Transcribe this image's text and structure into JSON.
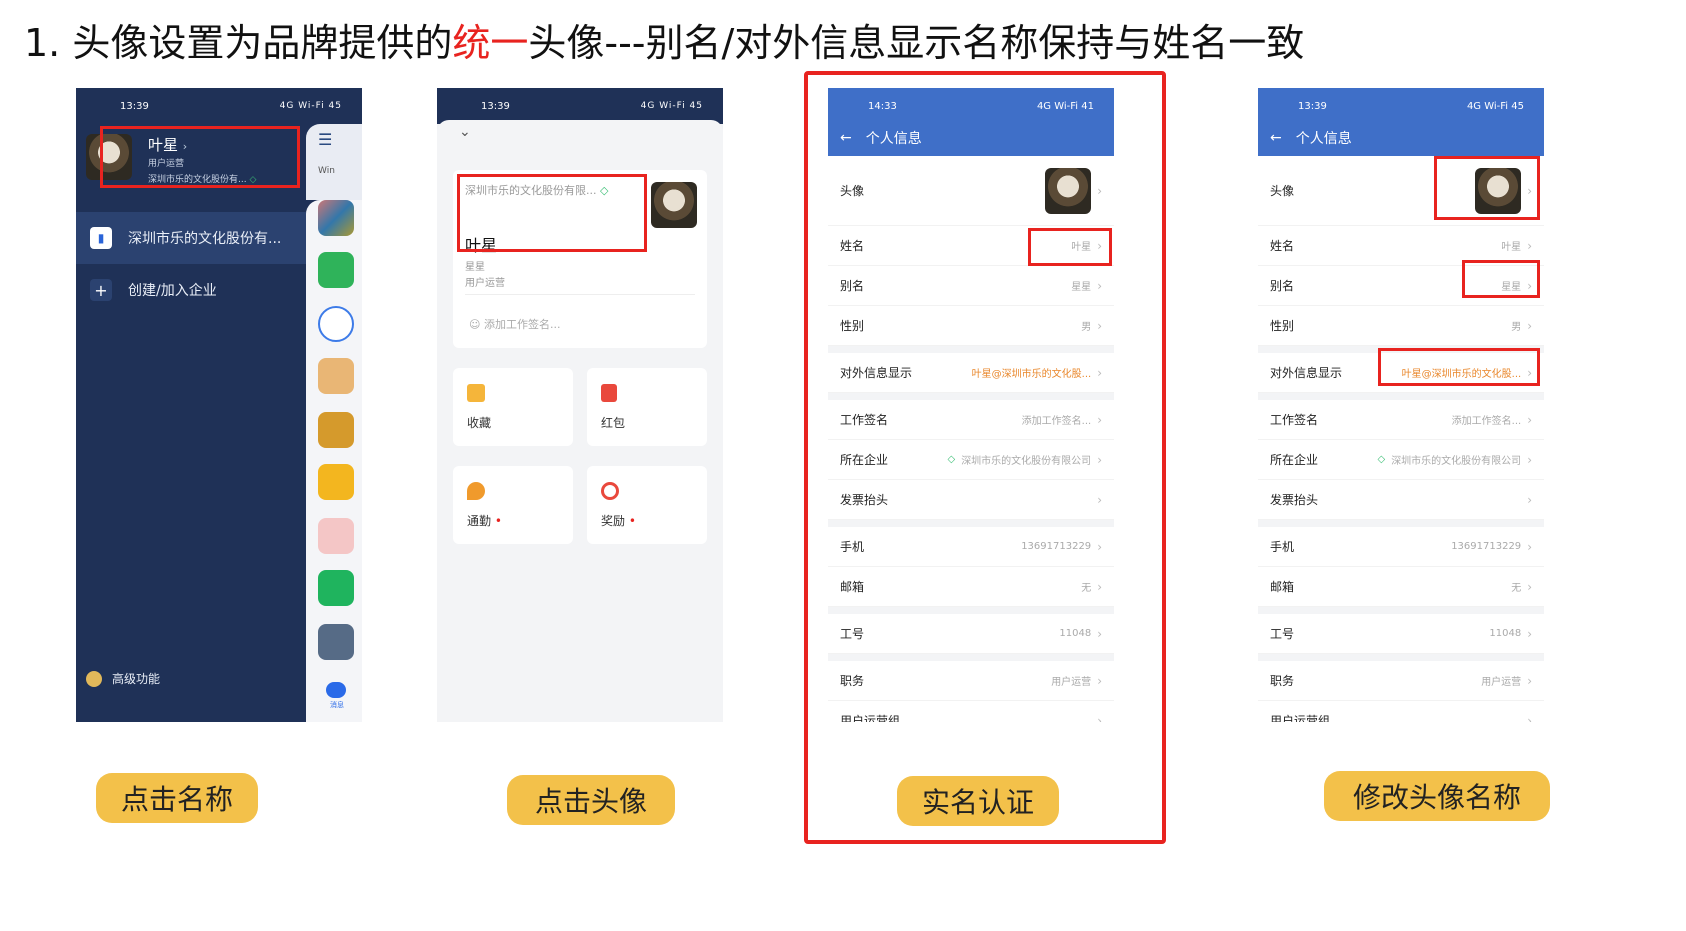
{
  "title": {
    "part1": "1. 头像设置为品牌提供的",
    "highlight": "统一",
    "part2": "头像---别名/对外信息显示名称保持与姓名一致"
  },
  "colors": {
    "highlight": "#e8231f",
    "pill": "#f3c14a",
    "header_blue": "#3f6fc8",
    "sidebar": "#1f3157"
  },
  "phone1": {
    "time": "13:39",
    "status_right": "4G Wi-Fi 45",
    "name": "叶星",
    "role": "用户运营",
    "company_short": "深圳市乐的文化股份有...",
    "company_item": "深圳市乐的文化股份有...",
    "create_join": "创建/加入企业",
    "advanced": "高级功能",
    "strip_label": "Win",
    "msg_tab": "消息"
  },
  "phone2": {
    "time": "13:39",
    "status_right": "4G Wi-Fi 45",
    "company": "深圳市乐的文化股份有限...",
    "name": "叶星",
    "alias": "星星",
    "role": "用户运营",
    "sign_placeholder": "添加工作签名...",
    "tiles": [
      {
        "label": "收藏",
        "icon": "box-icon"
      },
      {
        "label": "红包",
        "icon": "red-envelope-icon"
      },
      {
        "label": "通勤",
        "icon": "location-icon"
      },
      {
        "label": "奖励",
        "icon": "medal-icon"
      }
    ]
  },
  "phone3": {
    "time": "14:33",
    "status_right": "4G Wi-Fi 41",
    "header": "个人信息",
    "rows": [
      {
        "k": "头像",
        "v": ""
      },
      {
        "k": "姓名",
        "v": "叶星"
      },
      {
        "k": "别名",
        "v": "星星"
      },
      {
        "k": "性别",
        "v": "男"
      },
      {
        "k": "对外信息显示",
        "v": "叶星@深圳市乐的文化股..."
      },
      {
        "k": "工作签名",
        "v": "添加工作签名..."
      },
      {
        "k": "所在企业",
        "v": "深圳市乐的文化股份有限公司"
      },
      {
        "k": "发票抬头",
        "v": ""
      },
      {
        "k": "手机",
        "v": "13691713229"
      },
      {
        "k": "邮箱",
        "v": "无"
      },
      {
        "k": "工号",
        "v": "11048"
      },
      {
        "k": "职务",
        "v": "用户运营"
      },
      {
        "k": "用户运营组",
        "v": ""
      }
    ]
  },
  "phone4": {
    "time": "13:39",
    "status_right": "4G Wi-Fi 45",
    "header": "个人信息",
    "rows": [
      {
        "k": "头像",
        "v": ""
      },
      {
        "k": "姓名",
        "v": "叶星"
      },
      {
        "k": "别名",
        "v": "星星"
      },
      {
        "k": "性别",
        "v": "男"
      },
      {
        "k": "对外信息显示",
        "v": "叶星@深圳市乐的文化股..."
      },
      {
        "k": "工作签名",
        "v": "添加工作签名..."
      },
      {
        "k": "所在企业",
        "v": "深圳市乐的文化股份有限公司"
      },
      {
        "k": "发票抬头",
        "v": ""
      },
      {
        "k": "手机",
        "v": "13691713229"
      },
      {
        "k": "邮箱",
        "v": "无"
      },
      {
        "k": "工号",
        "v": "11048"
      },
      {
        "k": "职务",
        "v": "用户运营"
      },
      {
        "k": "用户运营组",
        "v": ""
      }
    ]
  },
  "pills": {
    "p1": "点击名称",
    "p2": "点击头像",
    "p3": "实名认证",
    "p4": "修改头像名称"
  }
}
